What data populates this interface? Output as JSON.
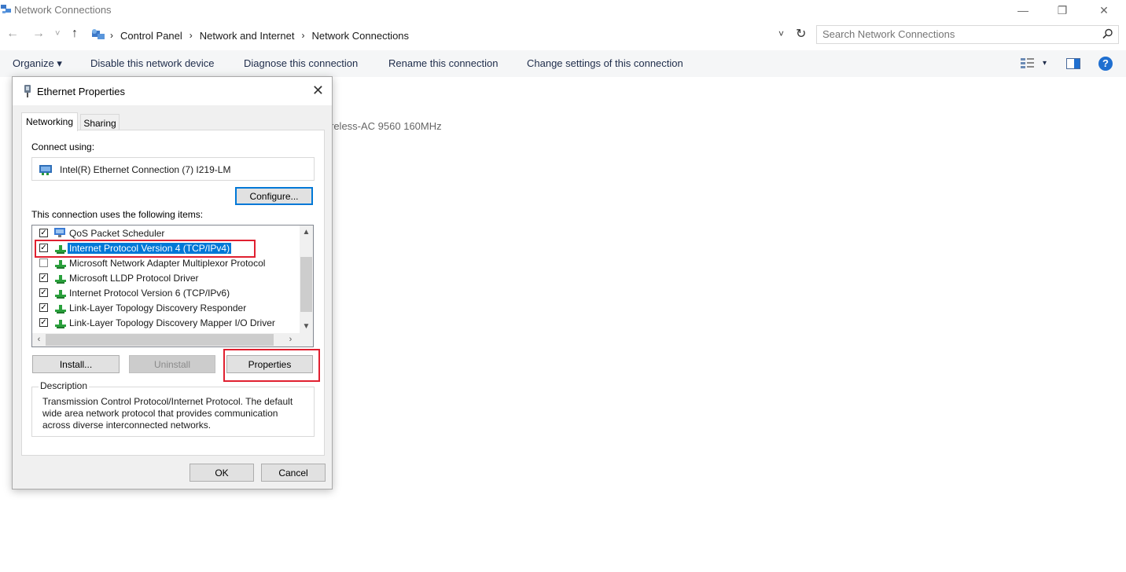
{
  "window": {
    "title": "Network Connections",
    "minimize": "—",
    "restore": "❐",
    "close": "✕"
  },
  "address": {
    "back": "←",
    "forward": "→",
    "recent": "˅",
    "up": "↑",
    "crumbs": [
      "Control Panel",
      "Network and Internet",
      "Network Connections"
    ],
    "separator": "›",
    "dropdown": "˅",
    "refresh": "↻",
    "search_placeholder": "Search Network Connections"
  },
  "commands": {
    "organize": "Organize ▾",
    "disable": "Disable this network device",
    "diagnose": "Diagnose this connection",
    "rename": "Rename this connection",
    "change": "Change settings of this connection",
    "view_dropdown": "▾",
    "help": "?"
  },
  "background": {
    "adapter_fragment": "reless-AC 9560 160MHz"
  },
  "dialog": {
    "title": "Ethernet Properties",
    "close": "✕",
    "tabs": [
      "Networking",
      "Sharing"
    ],
    "connect_using_label": "Connect using:",
    "adapter_name": "Intel(R) Ethernet Connection (7) I219-LM",
    "configure_button": "Configure...",
    "items_label": "This connection uses the following items:",
    "items": [
      {
        "label": "QoS Packet Scheduler",
        "checked": true,
        "selected": false
      },
      {
        "label": "Internet Protocol Version 4 (TCP/IPv4)",
        "checked": true,
        "selected": true
      },
      {
        "label": "Microsoft Network Adapter Multiplexor Protocol",
        "checked": false,
        "selected": false
      },
      {
        "label": "Microsoft LLDP Protocol Driver",
        "checked": true,
        "selected": false
      },
      {
        "label": "Internet Protocol Version 6 (TCP/IPv6)",
        "checked": true,
        "selected": false
      },
      {
        "label": "Link-Layer Topology Discovery Responder",
        "checked": true,
        "selected": false
      },
      {
        "label": "Link-Layer Topology Discovery Mapper I/O Driver",
        "checked": true,
        "selected": false
      }
    ],
    "check_mark": "✓",
    "scroll_up": "▲",
    "scroll_down": "▼",
    "scroll_left": "‹",
    "scroll_right": "›",
    "install_button": "Install...",
    "uninstall_button": "Uninstall",
    "properties_button": "Properties",
    "description_title": "Description",
    "description_text": "Transmission Control Protocol/Internet Protocol. The default wide area network protocol that provides communication across diverse interconnected networks.",
    "ok_button": "OK",
    "cancel_button": "Cancel"
  },
  "colors": {
    "accent": "#0078d7",
    "highlight_box": "#e02030",
    "command_text": "#1e2c4a"
  }
}
